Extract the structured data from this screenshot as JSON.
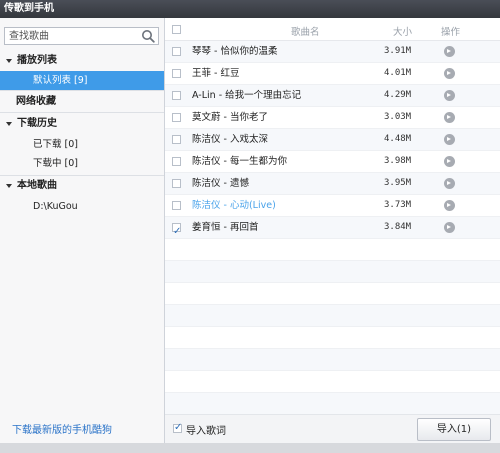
{
  "window": {
    "title": "传歌到手机"
  },
  "sidebar": {
    "search_placeholder": "查找歌曲",
    "sections": [
      {
        "label": "播放列表",
        "children": [
          {
            "label": "默认列表 [9]",
            "selected": true
          }
        ]
      },
      {
        "label": "网络收藏",
        "children": []
      },
      {
        "label": "下载历史",
        "children": [
          {
            "label": "已下载 [0]"
          },
          {
            "label": "下载中 [0]"
          }
        ]
      },
      {
        "label": "本地歌曲",
        "children": [
          {
            "label": "D:\\KuGou"
          }
        ]
      }
    ],
    "footer_link": "下载最新版的手机酷狗"
  },
  "table": {
    "headers": {
      "name": "歌曲名",
      "size": "大小",
      "action": "操作"
    },
    "rows": [
      {
        "title": "琴琴 - 恰似你的温柔",
        "size": "3.91M",
        "checked": false
      },
      {
        "title": "王菲 - 红豆",
        "size": "4.01M",
        "checked": false
      },
      {
        "title": "A-Lin - 给我一个理由忘记",
        "size": "4.29M",
        "checked": false
      },
      {
        "title": "莫文蔚 - 当你老了",
        "size": "3.03M",
        "checked": false
      },
      {
        "title": "陈洁仪 - 入戏太深",
        "size": "4.48M",
        "checked": false
      },
      {
        "title": "陈洁仪 - 每一生都为你",
        "size": "3.98M",
        "checked": false
      },
      {
        "title": "陈洁仪 - 遗憾",
        "size": "3.95M",
        "checked": false
      },
      {
        "title": "陈洁仪 - 心动(Live)",
        "size": "3.73M",
        "checked": false,
        "highlight": true
      },
      {
        "title": "姜育恒 - 再回首",
        "size": "3.84M",
        "checked": true
      }
    ]
  },
  "bottom": {
    "lyrics_label": "导入歌词",
    "lyrics_checked": true,
    "import_button": "导入(1)"
  },
  "colors": {
    "accent": "#3f9be8",
    "highlight_text": "#4aa3ea",
    "link": "#2a73c8"
  }
}
